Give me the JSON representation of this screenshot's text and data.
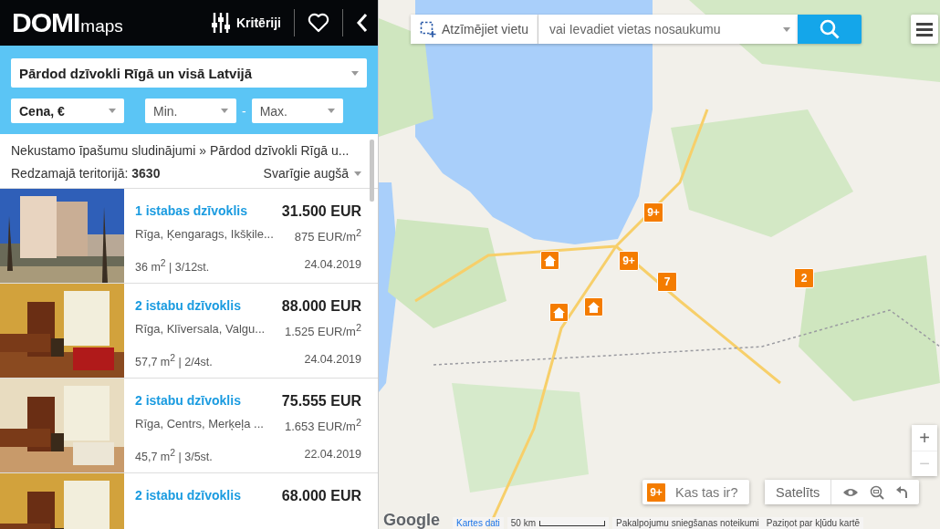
{
  "header": {
    "logo_main": "DOMI",
    "logo_sub": "maps",
    "criteria_button": "Kritēriji"
  },
  "filters": {
    "deal": "Pārdod dzīvokli Rīgā un visā Latvijā",
    "sort_field": "Cena, €",
    "min_placeholder": "Min.",
    "separator": "-",
    "max_placeholder": "Max."
  },
  "breadcrumb": "Nekustamo īpašumu sludinājumi » Pārdod dzīvokli Rīgā u...",
  "count_label": "Redzamajā teritorijā:",
  "count": "3630",
  "sort": "Svarīgie augšā",
  "listings": [
    {
      "title": "1 istabas dzīvoklis",
      "price": "31.500 EUR",
      "location": "Rīga, Ķengarags, Ikšķile...",
      "price_per_m2": "875 EUR/m$^{2}$",
      "area": "36 m$^{2}$ | 3/12st.",
      "date": "24.04.2019"
    },
    {
      "title": "2 istabu dzīvoklis",
      "price": "88.000 EUR",
      "location": "Rīga, Klīversala, Valgu...",
      "price_per_m2": "1.525 EUR/m$^{2}$",
      "area": "57,7 m$^{2}$ | 2/4st.",
      "date": "24.04.2019"
    },
    {
      "title": "2 istabu dzīvoklis",
      "price": "75.555 EUR",
      "location": "Rīga, Centrs, Merķeļa ...",
      "price_per_m2": "1.653 EUR/m$^{2}$",
      "area": "45,7 m$^{2}$ | 3/5st.",
      "date": "22.04.2019"
    },
    {
      "title": "2 istabu dzīvoklis",
      "price": "68.000 EUR"
    }
  ],
  "map_search": {
    "draw_button": "Atzīmējiet vietu",
    "placeholder": "vai Ievadiet vietas nosaukumu"
  },
  "markers": [
    {
      "kind": "cluster",
      "label": "9+"
    },
    {
      "kind": "cluster",
      "label": "9+"
    },
    {
      "kind": "cluster",
      "label": "7"
    },
    {
      "kind": "cluster",
      "label": "2"
    },
    {
      "kind": "house"
    },
    {
      "kind": "house"
    },
    {
      "kind": "house"
    }
  ],
  "zoom": {
    "in": "+",
    "out": "−"
  },
  "legend": {
    "badge": "9+",
    "label": "Kas tas ir?"
  },
  "map_type_button": "Satelīts",
  "attribution": {
    "logo": "Google",
    "data_link": "Kartes dati",
    "scale": "50 km",
    "terms": "Pakalpojumu sniegšanas noteikumi",
    "report": "Paziņot par kļūdu kartē"
  }
}
